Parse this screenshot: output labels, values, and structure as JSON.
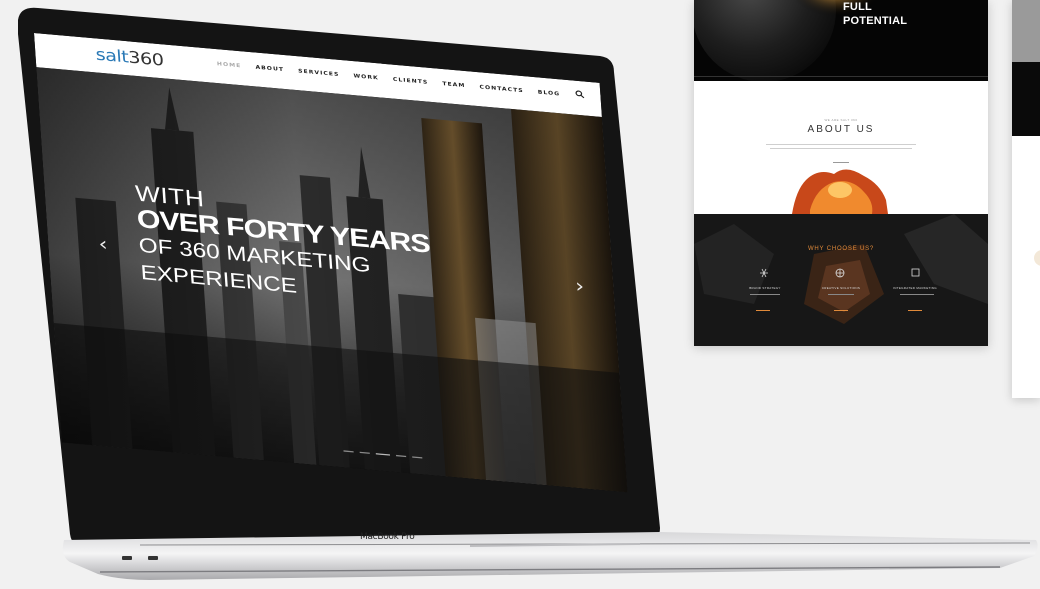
{
  "laptop": {
    "nav": {
      "logo_accent": "salt",
      "logo_dark": "360",
      "menu": [
        "HOME",
        "ABOUT",
        "SERVICES",
        "WORK",
        "CLIENTS",
        "TEAM",
        "CONTACTS",
        "BLOG"
      ]
    },
    "hero": {
      "line1": "WITH",
      "line2": "OVER FORTY YEARS",
      "line3": "OF 360 MARKETING",
      "line4": "EXPERIENCE"
    },
    "brand_label": "MacBook Pro"
  },
  "panel2": {
    "hero_line1": "FULL",
    "hero_line2": "POTENTIAL",
    "about_eyebrow": "WE ARE SALT 360",
    "about_title": "ABOUT US",
    "why_title": "WHY CHOOSE US?",
    "features": [
      "BRAND STRATEGY",
      "CREATIVE SOLUTIONS",
      "INTEGRATED MARKETING"
    ]
  },
  "colors": {
    "logo_blue": "#2a79b6",
    "accent_orange": "#e08a3a",
    "background": "#f1f1f1"
  },
  "icons": [
    "search-icon",
    "chevron-left-icon",
    "chevron-right-icon"
  ]
}
